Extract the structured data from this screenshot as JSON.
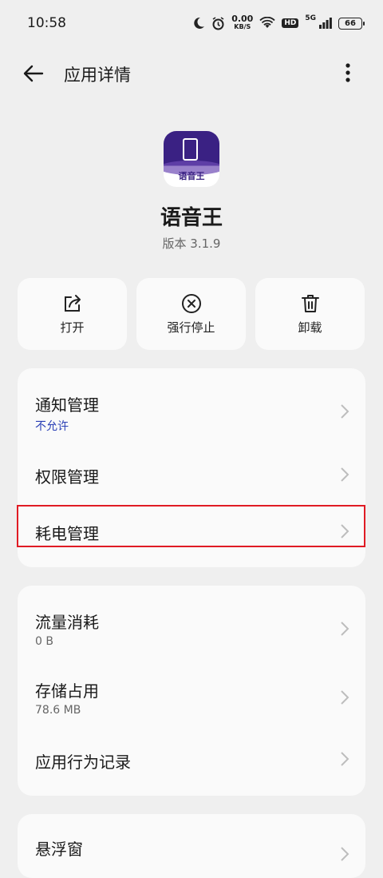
{
  "status_bar": {
    "time": "10:58",
    "net_speed_value": "0.00",
    "net_speed_unit": "KB/S",
    "hd_label": "HD",
    "signal_label": "5G",
    "battery_level": "66"
  },
  "app_bar": {
    "title": "应用详情"
  },
  "app_info": {
    "icon_text": "语音王",
    "name": "语音王",
    "version": "版本 3.1.9"
  },
  "actions": {
    "open_label": "打开",
    "force_stop_label": "强行停止",
    "uninstall_label": "卸载"
  },
  "card1": {
    "notification": {
      "title": "通知管理",
      "sub": "不允许"
    },
    "permission": {
      "title": "权限管理"
    },
    "battery": {
      "title": "耗电管理"
    }
  },
  "card2": {
    "data_usage": {
      "title": "流量消耗",
      "sub": "0 B"
    },
    "storage": {
      "title": "存储占用",
      "sub": "78.6 MB"
    },
    "behavior": {
      "title": "应用行为记录"
    }
  },
  "card3": {
    "floating": {
      "title": "悬浮窗"
    }
  },
  "colors": {
    "accent_blue": "#2a3fb5",
    "highlight_red": "#e01b24",
    "icon_purple": "#3a2183"
  }
}
